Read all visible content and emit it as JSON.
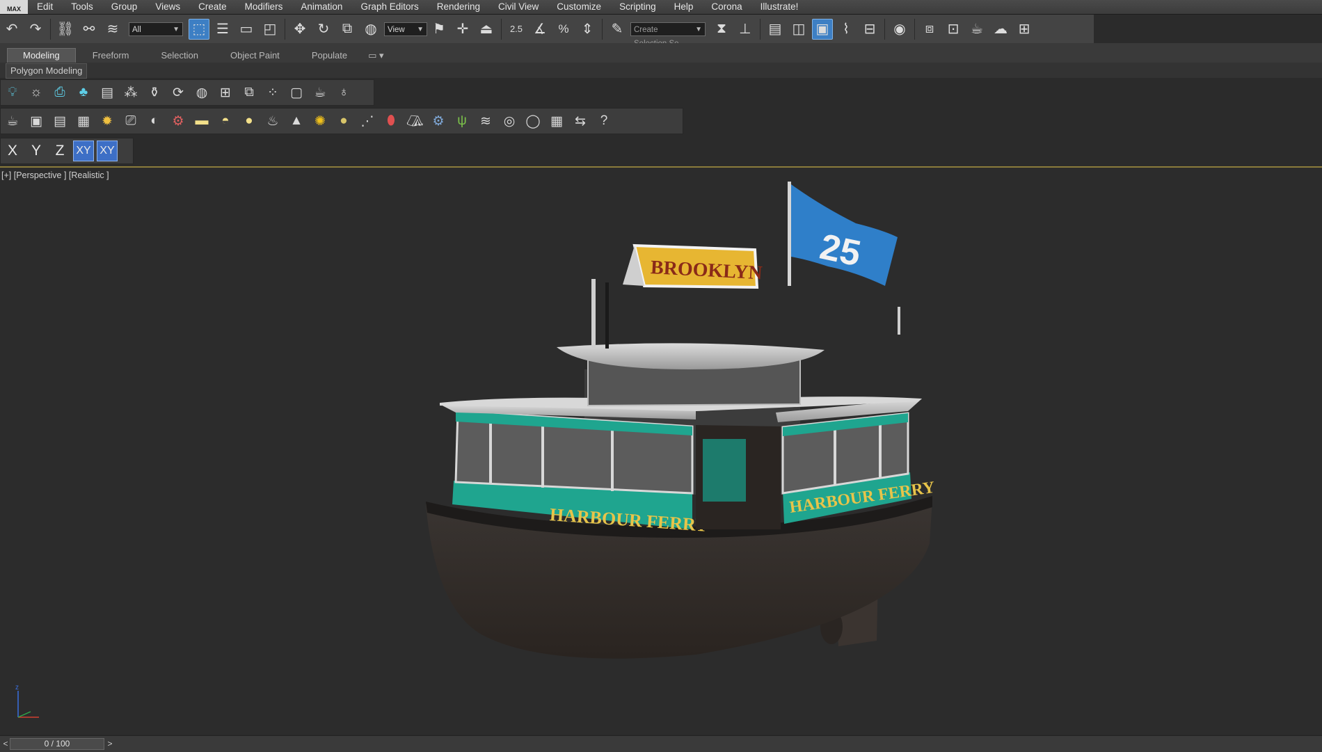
{
  "app": {
    "logo_text": "MAX"
  },
  "menu": [
    "Edit",
    "Tools",
    "Group",
    "Views",
    "Create",
    "Modifiers",
    "Animation",
    "Graph Editors",
    "Rendering",
    "Civil View",
    "Customize",
    "Scripting",
    "Help",
    "Corona",
    "Illustrate!"
  ],
  "toolbar": {
    "selection_filter": "All",
    "reference_coord": "View",
    "selection_set_placeholder": "Create Selection Se",
    "snap_label": "2.5"
  },
  "ribbon": {
    "tabs": [
      "Modeling",
      "Freeform",
      "Selection",
      "Object Paint",
      "Populate"
    ],
    "active_tab": "Modeling",
    "panel_label": "Polygon Modeling"
  },
  "axis_constraints": [
    "X",
    "Y",
    "Z",
    "XY",
    "XY"
  ],
  "viewport": {
    "label": "[+] [Perspective ] [Realistic ]",
    "gizmo_axis": "z"
  },
  "timeline": {
    "frame": "0 / 100",
    "prev": "<",
    "next": ">"
  },
  "colors": {
    "ui_bg": "#444444",
    "viewport_bg": "#2c2c2c",
    "accent_blue": "#3d7fc4",
    "hull_green": "#1fa58f",
    "flag_blue": "#2f7fc9",
    "sign_yellow": "#e7b632"
  },
  "scene": {
    "sign_text": "BROOKLYN",
    "hull_text_left": "HARBOUR FERRY",
    "hull_text_right": "HARBOUR FERRY",
    "flag_text": "25"
  }
}
